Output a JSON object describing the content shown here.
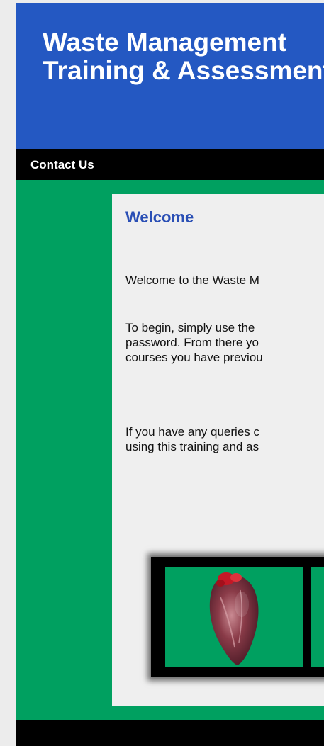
{
  "header": {
    "title_line1": "Waste Management",
    "title_line2": "Training & Assessment"
  },
  "nav": {
    "contact_label": "Contact Us"
  },
  "main": {
    "welcome_title": "Welcome",
    "paragraph1": "Welcome to the Waste M",
    "paragraph2_line1": "To begin, simply use the",
    "paragraph2_line2": "password. From there yo",
    "paragraph2_line3": "courses you have previou",
    "paragraph3_line1": "If you have any queries c",
    "paragraph3_line2": "using this training and as"
  },
  "colors": {
    "header_blue": "#2458c2",
    "page_green": "#00a060",
    "nav_black": "#000000",
    "title_blue": "#2a4fb5"
  }
}
